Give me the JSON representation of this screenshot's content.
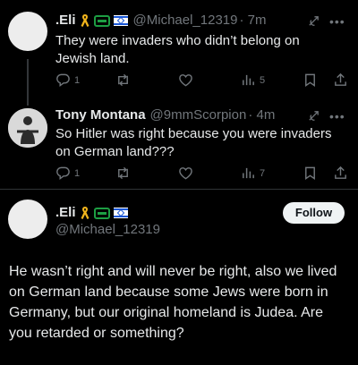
{
  "tweets": [
    {
      "display_name": ".Eli",
      "handle": "@Michael_12319",
      "time": "· 7m",
      "text": "They were invaders who didn’t belong on Jewish land.",
      "replies": "1",
      "retweets": "",
      "likes": "",
      "views": "5"
    },
    {
      "display_name": "Tony Montana",
      "handle": "@9mmScorpion",
      "time": "· 4m",
      "text": "So Hitler was right because you were invaders on German land???",
      "replies": "1",
      "retweets": "",
      "likes": "",
      "views": "7"
    }
  ],
  "main_tweet": {
    "display_name": ".Eli",
    "handle": "@Michael_12319",
    "follow_label": "Follow",
    "text": "He wasn’t right and will never be right, also we lived on German land because some Jews were born in Germany, but our original homeland is Judea. Are you retarded or something?"
  },
  "icons": {
    "reply": "reply-icon",
    "retweet": "retweet-icon",
    "like": "heart-icon",
    "views": "views-icon",
    "bookmark": "bookmark-icon",
    "share": "share-icon",
    "grok": "grok-icon",
    "more": "more-icon"
  },
  "colors": {
    "background": "#000000",
    "text": "#e7e9ea",
    "muted": "#71767b",
    "follow_bg": "#eff3f4"
  }
}
